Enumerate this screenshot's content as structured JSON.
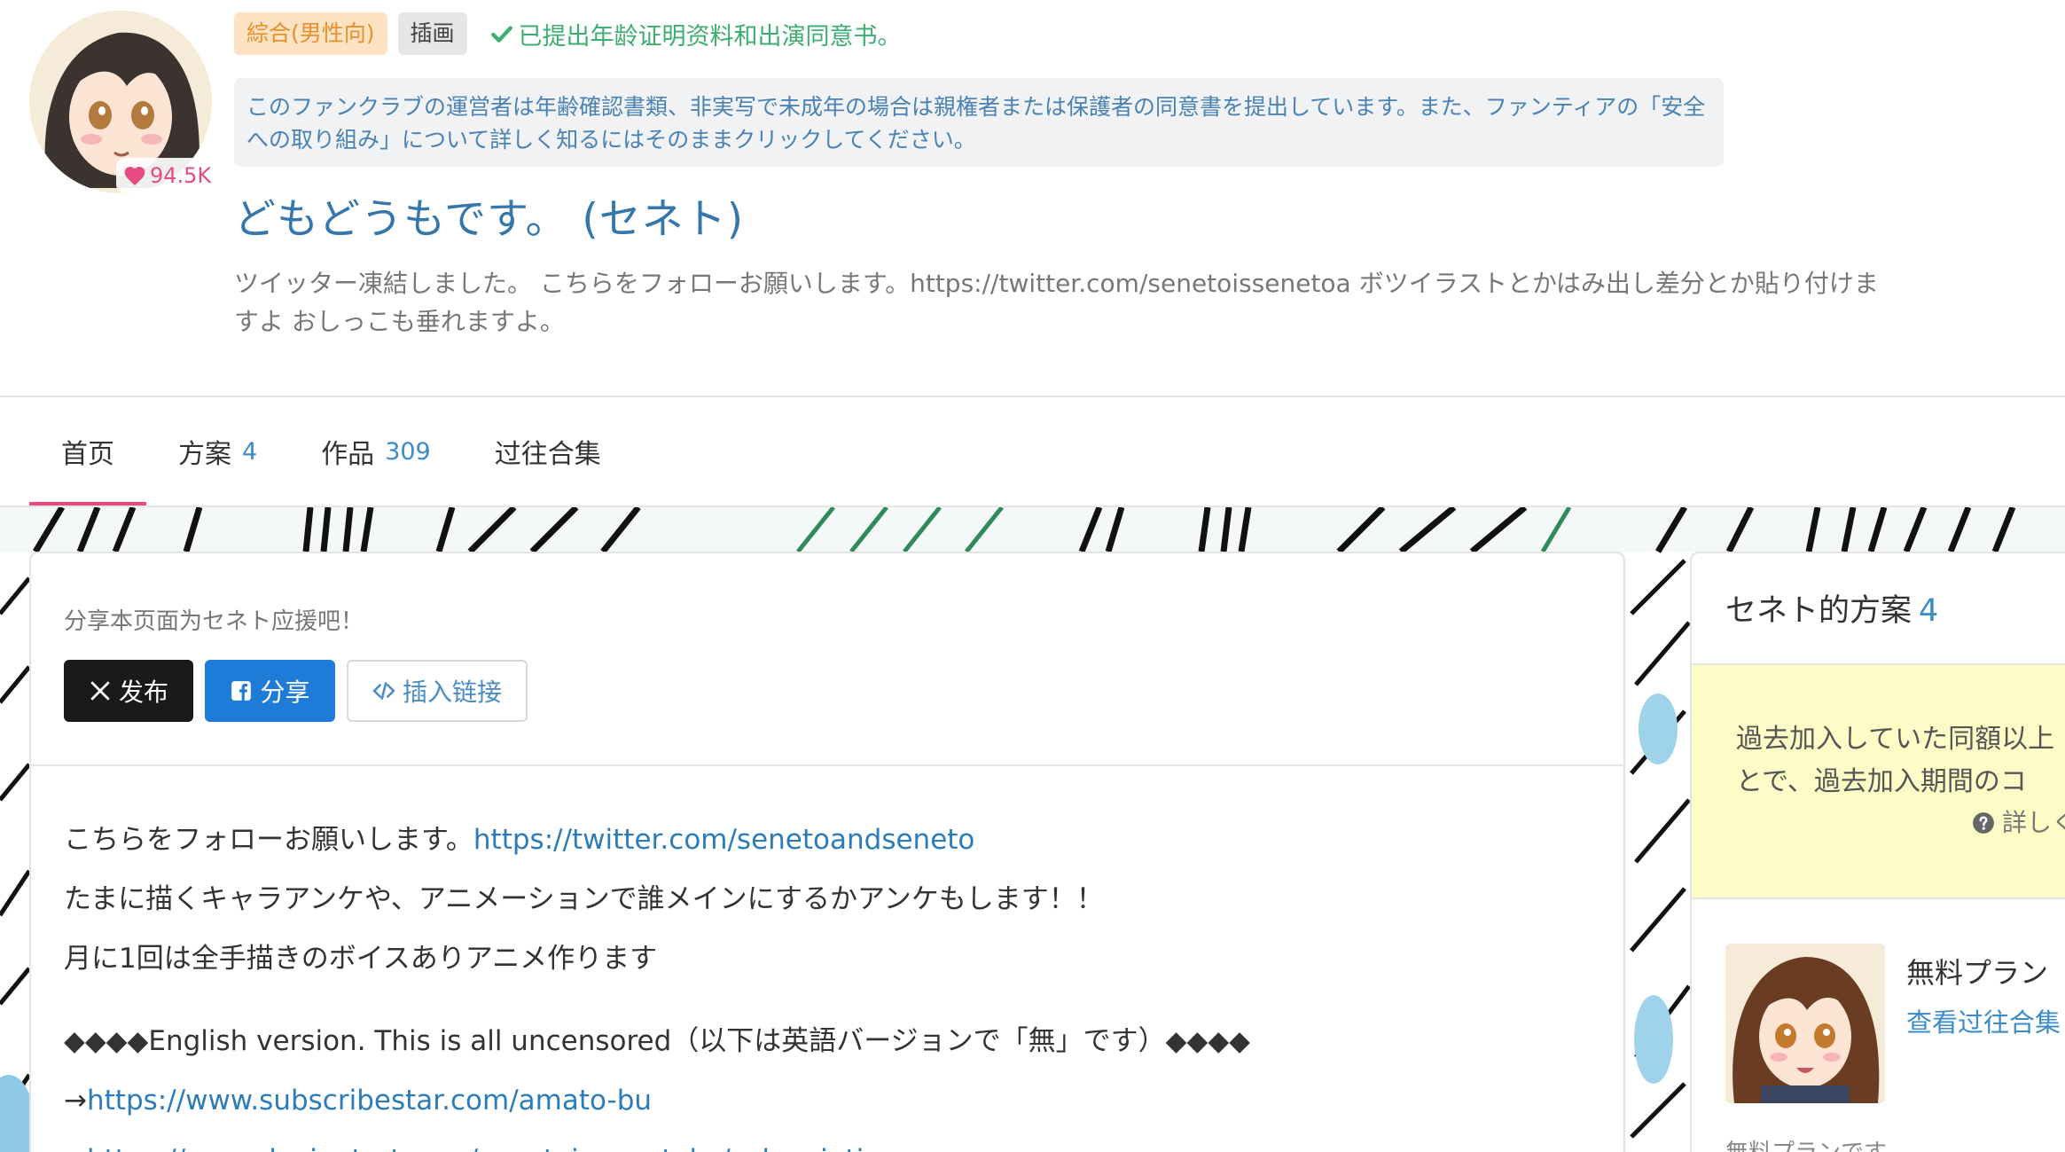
{
  "header": {
    "likes": "94.5K",
    "tags": [
      "綜合(男性向)",
      "插画"
    ],
    "verified_text": "已提出年龄证明资料和出演同意书。",
    "notice": "このファンクラブの運営者は年齢確認書類、非実写で未成年の場合は親権者または保護者の同意書を提出しています。また、ファンティアの「安全への取り組み」について詳しく知るにはそのままクリックしてください。",
    "creator_name": "どもどうもです。 (セネト)",
    "description": "ツイッター凍結しました。 こちらをフォローお願いします。https://twitter.com/senetoissenetoa ボツイラストとかはみ出し差分とか貼り付けますよ おしっこも垂れますよ。"
  },
  "tabs": [
    {
      "label": "首页",
      "count": ""
    },
    {
      "label": "方案",
      "count": "4"
    },
    {
      "label": "作品",
      "count": "309"
    },
    {
      "label": "过往合集",
      "count": ""
    }
  ],
  "share": {
    "title": "分享本页面为セネト应援吧！",
    "x_label": "发布",
    "facebook_label": "分享",
    "embed_label": "插入链接"
  },
  "body": {
    "line1_prefix": "こちらをフォローお願いします。",
    "line1_link": "https://twitter.com/senetoandseneto",
    "line2": "たまに描くキャラアンケや、アニメーションで誰メインにするかアンケもします！！",
    "line3": "月に1回は全手描きのボイスありアニメ作ります",
    "line4": "◆◆◆◆English version. This is all uncensored（以下は英語バージョンで「無」です）◆◆◆◆",
    "line5_prefix": "→",
    "line5_link": "https://www.subscribestar.com/amato-bu",
    "line6_prefix": "→",
    "line6_link": "https://www.deviantart.com/senetoisenentoko/subscriptions"
  },
  "side": {
    "title": "セネト的方案",
    "count": "4",
    "notice_line1": "過去加入していた同額以上",
    "notice_line2": "とで、過去加入期間のコ",
    "learn_more": "詳しく",
    "plan_name": "無料プラン",
    "plan_link": "查看过往合集",
    "plan_desc": "無料プランです"
  },
  "colors": {
    "accent_pink": "#e8497e",
    "link_blue": "#2c7cba",
    "verified_green": "#3cae6f",
    "tag_orange": "#e8902c",
    "facebook_blue": "#1f7bd8"
  },
  "icons": [
    "heart-icon",
    "check-icon",
    "x-logo-icon",
    "facebook-icon",
    "code-icon",
    "question-circle-icon"
  ]
}
